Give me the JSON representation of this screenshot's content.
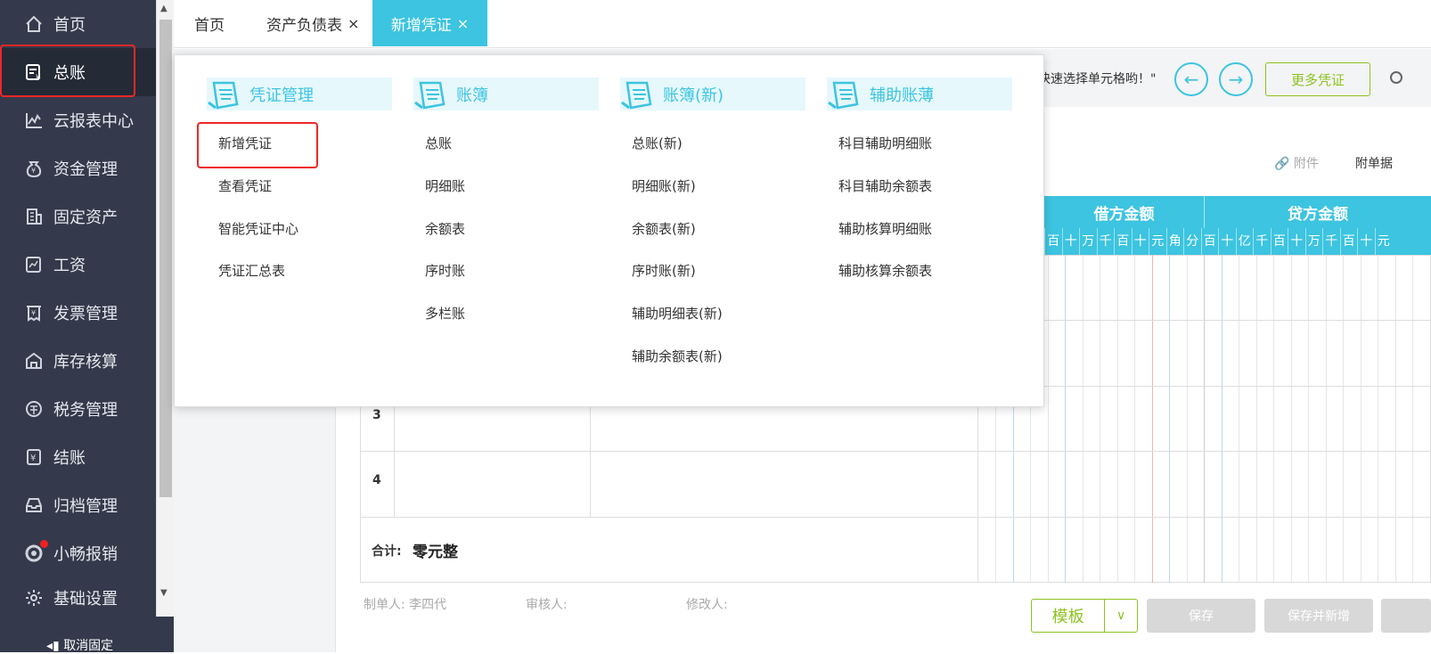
{
  "sidebar": {
    "items": [
      {
        "label": "首页",
        "icon": "home-icon"
      },
      {
        "label": "总账",
        "icon": "ledger-icon"
      },
      {
        "label": "云报表中心",
        "icon": "chart-icon"
      },
      {
        "label": "资金管理",
        "icon": "money-icon"
      },
      {
        "label": "固定资产",
        "icon": "building-icon"
      },
      {
        "label": "工资",
        "icon": "salary-icon"
      },
      {
        "label": "发票管理",
        "icon": "invoice-icon"
      },
      {
        "label": "库存核算",
        "icon": "warehouse-icon"
      },
      {
        "label": "税务管理",
        "icon": "tax-icon"
      },
      {
        "label": "结账",
        "icon": "checkout-icon"
      },
      {
        "label": "归档管理",
        "icon": "archive-icon"
      },
      {
        "label": "小畅报销",
        "icon": "reimburse-icon"
      },
      {
        "label": "基础设置",
        "icon": "gear-icon"
      }
    ],
    "unpin_label": "取消固定"
  },
  "tabs": [
    {
      "label": "首页"
    },
    {
      "label": "资产负债表",
      "close": "×"
    },
    {
      "label": "新增凭证",
      "close": "×"
    }
  ],
  "toolbar": {
    "hint": "快速选择单元格哟！\"",
    "prev_icon": "arrow-left-icon",
    "next_icon": "arrow-right-icon",
    "more_label": "更多凭证"
  },
  "voucher": {
    "attach_label": "附件",
    "attach_count_label": "附单据",
    "debit_header": "借方金额",
    "credit_header": "贷方金额",
    "debit_digits": [
      "百",
      "十",
      "万",
      "千",
      "百",
      "十",
      "元",
      "角",
      "分"
    ],
    "credit_digits": [
      "百",
      "十",
      "亿",
      "千",
      "百",
      "十",
      "万",
      "千",
      "百",
      "十",
      "元"
    ],
    "rows": [
      "3",
      "4"
    ],
    "total_label": "合计:",
    "total_value": "零元整",
    "maker_label": "制单人: 李四代",
    "reviewer_label": "审核人:",
    "modifier_label": "修改人:",
    "template_label": "模板",
    "save_label": "保存",
    "save_new_label": "保存并新增"
  },
  "dropdown": {
    "columns": [
      {
        "title": "凭证管理",
        "items": [
          "新增凭证",
          "查看凭证",
          "智能凭证中心",
          "凭证汇总表"
        ]
      },
      {
        "title": "账簿",
        "items": [
          "总账",
          "明细账",
          "余额表",
          "序时账",
          "多栏账"
        ]
      },
      {
        "title": "账簿(新)",
        "items": [
          "总账(新)",
          "明细账(新)",
          "余额表(新)",
          "序时账(新)",
          "辅助明细表(新)",
          "辅助余额表(新)"
        ]
      },
      {
        "title": "辅助账薄",
        "items": [
          "科目辅助明细账",
          "科目辅助余额表",
          "辅助核算明细账",
          "辅助核算余额表"
        ]
      }
    ]
  },
  "colors": {
    "accent": "#3cc4e0",
    "green": "#8dc21f",
    "sidebar": "#343a4b",
    "highlight": "#ef2727"
  }
}
